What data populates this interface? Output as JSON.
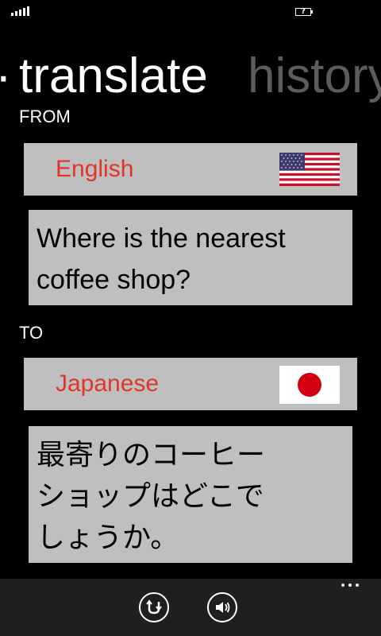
{
  "status": {
    "battery_indicator": "?"
  },
  "pivot": {
    "active": "translate",
    "inactive": "history"
  },
  "from": {
    "label": "FROM",
    "language": "English",
    "flag": "us-flag-icon",
    "text": "Where is the nearest\ncoffee shop?"
  },
  "to": {
    "label": "TO",
    "language": "Japanese",
    "flag": "japan-flag-icon",
    "text": "最寄りのコーヒー\nショップはどこで\nしょうか。"
  },
  "app_bar": {
    "buttons": [
      "swap-icon",
      "speaker-icon"
    ],
    "more": "ellipsis-icon"
  },
  "colors": {
    "accent": "#e0362a",
    "panel": "#bfbfbf",
    "app_bar": "#1f1f1f"
  }
}
